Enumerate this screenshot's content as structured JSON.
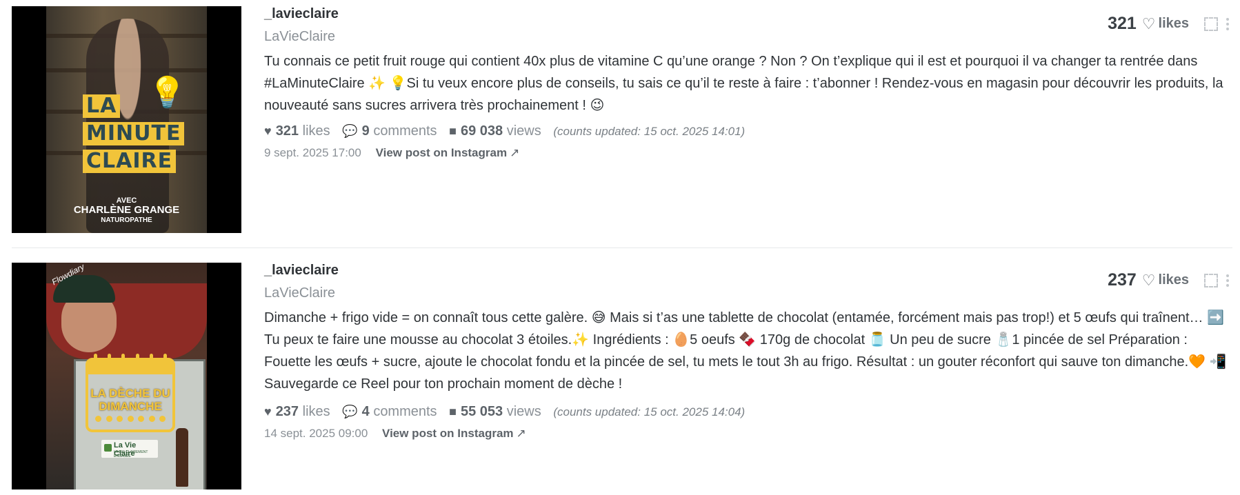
{
  "posts": [
    {
      "username": "_lavieclaire",
      "display_name": "LaVieClaire",
      "caption": "Tu connais ce petit fruit rouge qui contient 40x plus de vitamine C qu’une orange ? Non ? On t’explique qui il est et pourquoi il va changer ta rentrée dans #LaMinuteClaire ✨ 💡Si tu veux encore plus de conseils, tu sais ce qu’il te reste à faire : t’abonner ! Rendez-vous en magasin pour découvrir les produits, la nouveauté sans sucres arrivera très prochainement ! 😉",
      "likes_count": "321",
      "likes_label": "likes",
      "comments_count": "9",
      "comments_label": "comments",
      "views_count": "69 038",
      "views_label": "views",
      "counts_updated_prefix": "counts updated:",
      "counts_updated_time": "15 oct. 2025 14:01",
      "posted_at": "9 sept. 2025 17:00",
      "view_link_label": "View post on Instagram",
      "top_likes": "321",
      "top_likes_label": "likes",
      "thumbnail": {
        "lines": [
          "LA",
          "MINUTE",
          "CLAIRE"
        ],
        "sub_a": "AVEC",
        "sub_b": "CHARLÈNE GRANGE",
        "sub_c": "NATUROPATHE"
      }
    },
    {
      "username": "_lavieclaire",
      "display_name": "LaVieClaire",
      "caption": "Dimanche + frigo vide = on connaît tous cette galère. 😅 Mais si t’as une tablette de chocolat (entamée, forcément mais pas trop!) et 5 œufs qui traînent… ➡️ Tu peux te faire une mousse au chocolat 3 étoiles.✨ Ingrédients : 🥚5 oeufs 🍫 170g de chocolat 🫙 Un peu de sucre 🧂1 pincée de sel Préparation : Fouette les œufs + sucre, ajoute le chocolat fondu et la pincée de sel, tu mets le tout 3h au frigo. Résultat : un gouter réconfort qui sauve ton dimanche.🧡 📲 Sauvegarde ce Reel pour ton prochain moment de dèche !",
      "likes_count": "237",
      "likes_label": "likes",
      "comments_count": "4",
      "comments_label": "comments",
      "views_count": "55 053",
      "views_label": "views",
      "counts_updated_prefix": "counts updated:",
      "counts_updated_time": "15 oct. 2025 14:04",
      "posted_at": "14 sept. 2025 09:00",
      "view_link_label": "View post on Instagram",
      "top_likes": "237",
      "top_likes_label": "likes",
      "thumbnail": {
        "title_line_1": "LA DÈCHE DU",
        "title_line_2": "DIMANCHE",
        "logo_text": "La Vie Claire",
        "logo_sub": "LA BIO CLAIREMENT ENGAGÉE",
        "hand_text": "Flowdiary"
      }
    }
  ],
  "icons": {
    "heart": "heart-icon",
    "comment": "comment-icon",
    "views": "video-camera-icon",
    "external": "external-link-icon",
    "expand": "expand-icon",
    "more": "more-vertical-icon"
  }
}
